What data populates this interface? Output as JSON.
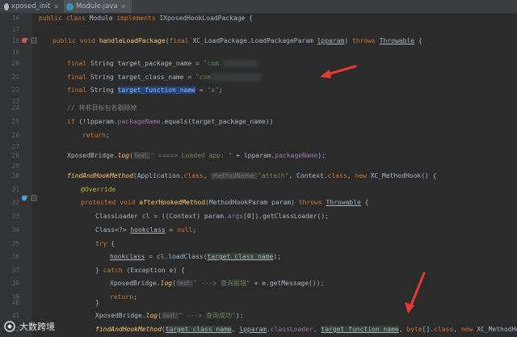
{
  "tabs": [
    {
      "label": "xposed_init",
      "active": false,
      "icon_color": "#a9b7c6"
    },
    {
      "label": "Module.java",
      "active": true,
      "icon_color": "#3592c4"
    }
  ],
  "line_numbers": [
    "16",
    "17",
    "18",
    "19",
    "20",
    "21",
    "22",
    "23",
    "24",
    "25",
    "26",
    "27",
    "28",
    "29",
    "30",
    "31",
    "32",
    "33",
    "34",
    "35",
    "36",
    "37",
    "38",
    "39",
    "40",
    "41",
    "42"
  ],
  "code": {
    "l16": {
      "kw1": "public class",
      "name": "Module",
      "kw2": "implements",
      "iface": "IXposedHookLoadPackage",
      "brace": "{"
    },
    "l18": {
      "kw1": "public void",
      "fn": "handleLoadPackage",
      "p1": "(",
      "kw2": "final",
      "t": "XC_LoadPackage.LoadPackageParam",
      "pn": "lpparam",
      ") ": ") ",
      "kw3": "throws",
      "exc": "Throwable",
      "brace": "{"
    },
    "l20": {
      "kw": "final",
      "t": "String",
      "var": "target_package_name",
      "eq": " = ",
      "str": "\"com.",
      "blurred": "xxxxxxx\";"
    },
    "l21": {
      "kw": "final",
      "t": "String",
      "var": "target_class_name",
      "eq": " = ",
      "str": "\"com",
      "blurred": "xxxxxxxxxxx\";"
    },
    "l22": {
      "kw": "final",
      "t": "String",
      "var": "target_function_name",
      "eq": " = ",
      "str": "\"a\"",
      "end": ";"
    },
    "l24": {
      "comment": "// 将非目标包名剔除掉"
    },
    "l25": {
      "kw": "if",
      "p1": " (!",
      "obj": "lpparam",
      "dot": ".",
      "fld": "packageName",
      ".equals(target_package_name))": ".equals(target_package_name))"
    },
    "l26": {
      "kw": "return",
      "end": ";"
    },
    "l28": {
      "cls": "XposedBridge.",
      "fn": "log",
      "p1": "(",
      "hint": "text:",
      "str": "\" ====> Loaded app: \"",
      "rest": " + lpparam.",
      "fld": "packageName",
      "end": ");"
    },
    "l30": {
      "fn": "findAndHookMethod",
      "p1": "(Application.",
      "kw": "class",
      ", ": ", ",
      "hint": "methodName:",
      "str": "\"attach\"",
      "rest": ", Context.",
      "kw2": "class",
      ",": ", ",
      "kw3": "new",
      "cls": "XC_MethodHook",
      "end": "() {"
    },
    "l31": {
      "ann": "@Override"
    },
    "l32": {
      "kw": "protected void",
      "fn": "afterHookedMethod",
      "p1": "(MethodHookParam param) ",
      "kw2": "throws",
      "exc": "Throwable",
      "brace": "{"
    },
    "l33": {
      "t": "ClassLoader cl = ((Context) param.",
      "fld": "args",
      "rest": "[0]).getClassLoader();"
    },
    "l34": {
      "t": "Class<?> ",
      "var": "hookclass",
      "rest": " = ",
      "kw": "null",
      ";": ";"
    },
    "l35": {
      "kw": "try",
      "brace": " {"
    },
    "l36": {
      "var": "hookclass",
      "rest": " = cl.loadClass(",
      "arg": "target_class_name",
      "end": ");"
    },
    "l37": {
      "brace1": "} ",
      "kw": "catch",
      "rest": " (Exception e) {"
    },
    "l38": {
      "cls": "XposedBridge.",
      "fn": "log",
      "p1": "(",
      "hint": "text:",
      "str": "\" ---> 查询报错\"",
      "rest": " + e.getMessage());"
    },
    "l39": {
      "kw": "return",
      "end": ";"
    },
    "l40": {
      "brace": "}"
    },
    "l41": {
      "cls": "XposedBridge.",
      "fn": "log",
      "p1": "(",
      "hint": "text:",
      "str": "\" ---> 查询成功\"",
      "end": ");"
    },
    "l42": {
      "fn": "findAndHookMethod",
      "p1": "(",
      "a1": "target_class_name",
      ", ": ", ",
      "a2": "lpparam",
      ".": ".",
      "f1": "classLoader",
      "a3": "target_function_name",
      "kw": "byte",
      "rest": "[].",
      "kw2": "class",
      ",": ", ",
      "kw3": "new",
      "cls": "XC_MethodHook",
      "end": "() {"
    }
  },
  "watermark": {
    "text": "大数跨境",
    "icon": "logo-icon"
  },
  "colors": {
    "arrow": "#e53935",
    "background": "#2b2b2b",
    "keyword": "#cc7832",
    "string": "#6a8759",
    "field": "#9876aa",
    "method": "#ffc66d"
  }
}
